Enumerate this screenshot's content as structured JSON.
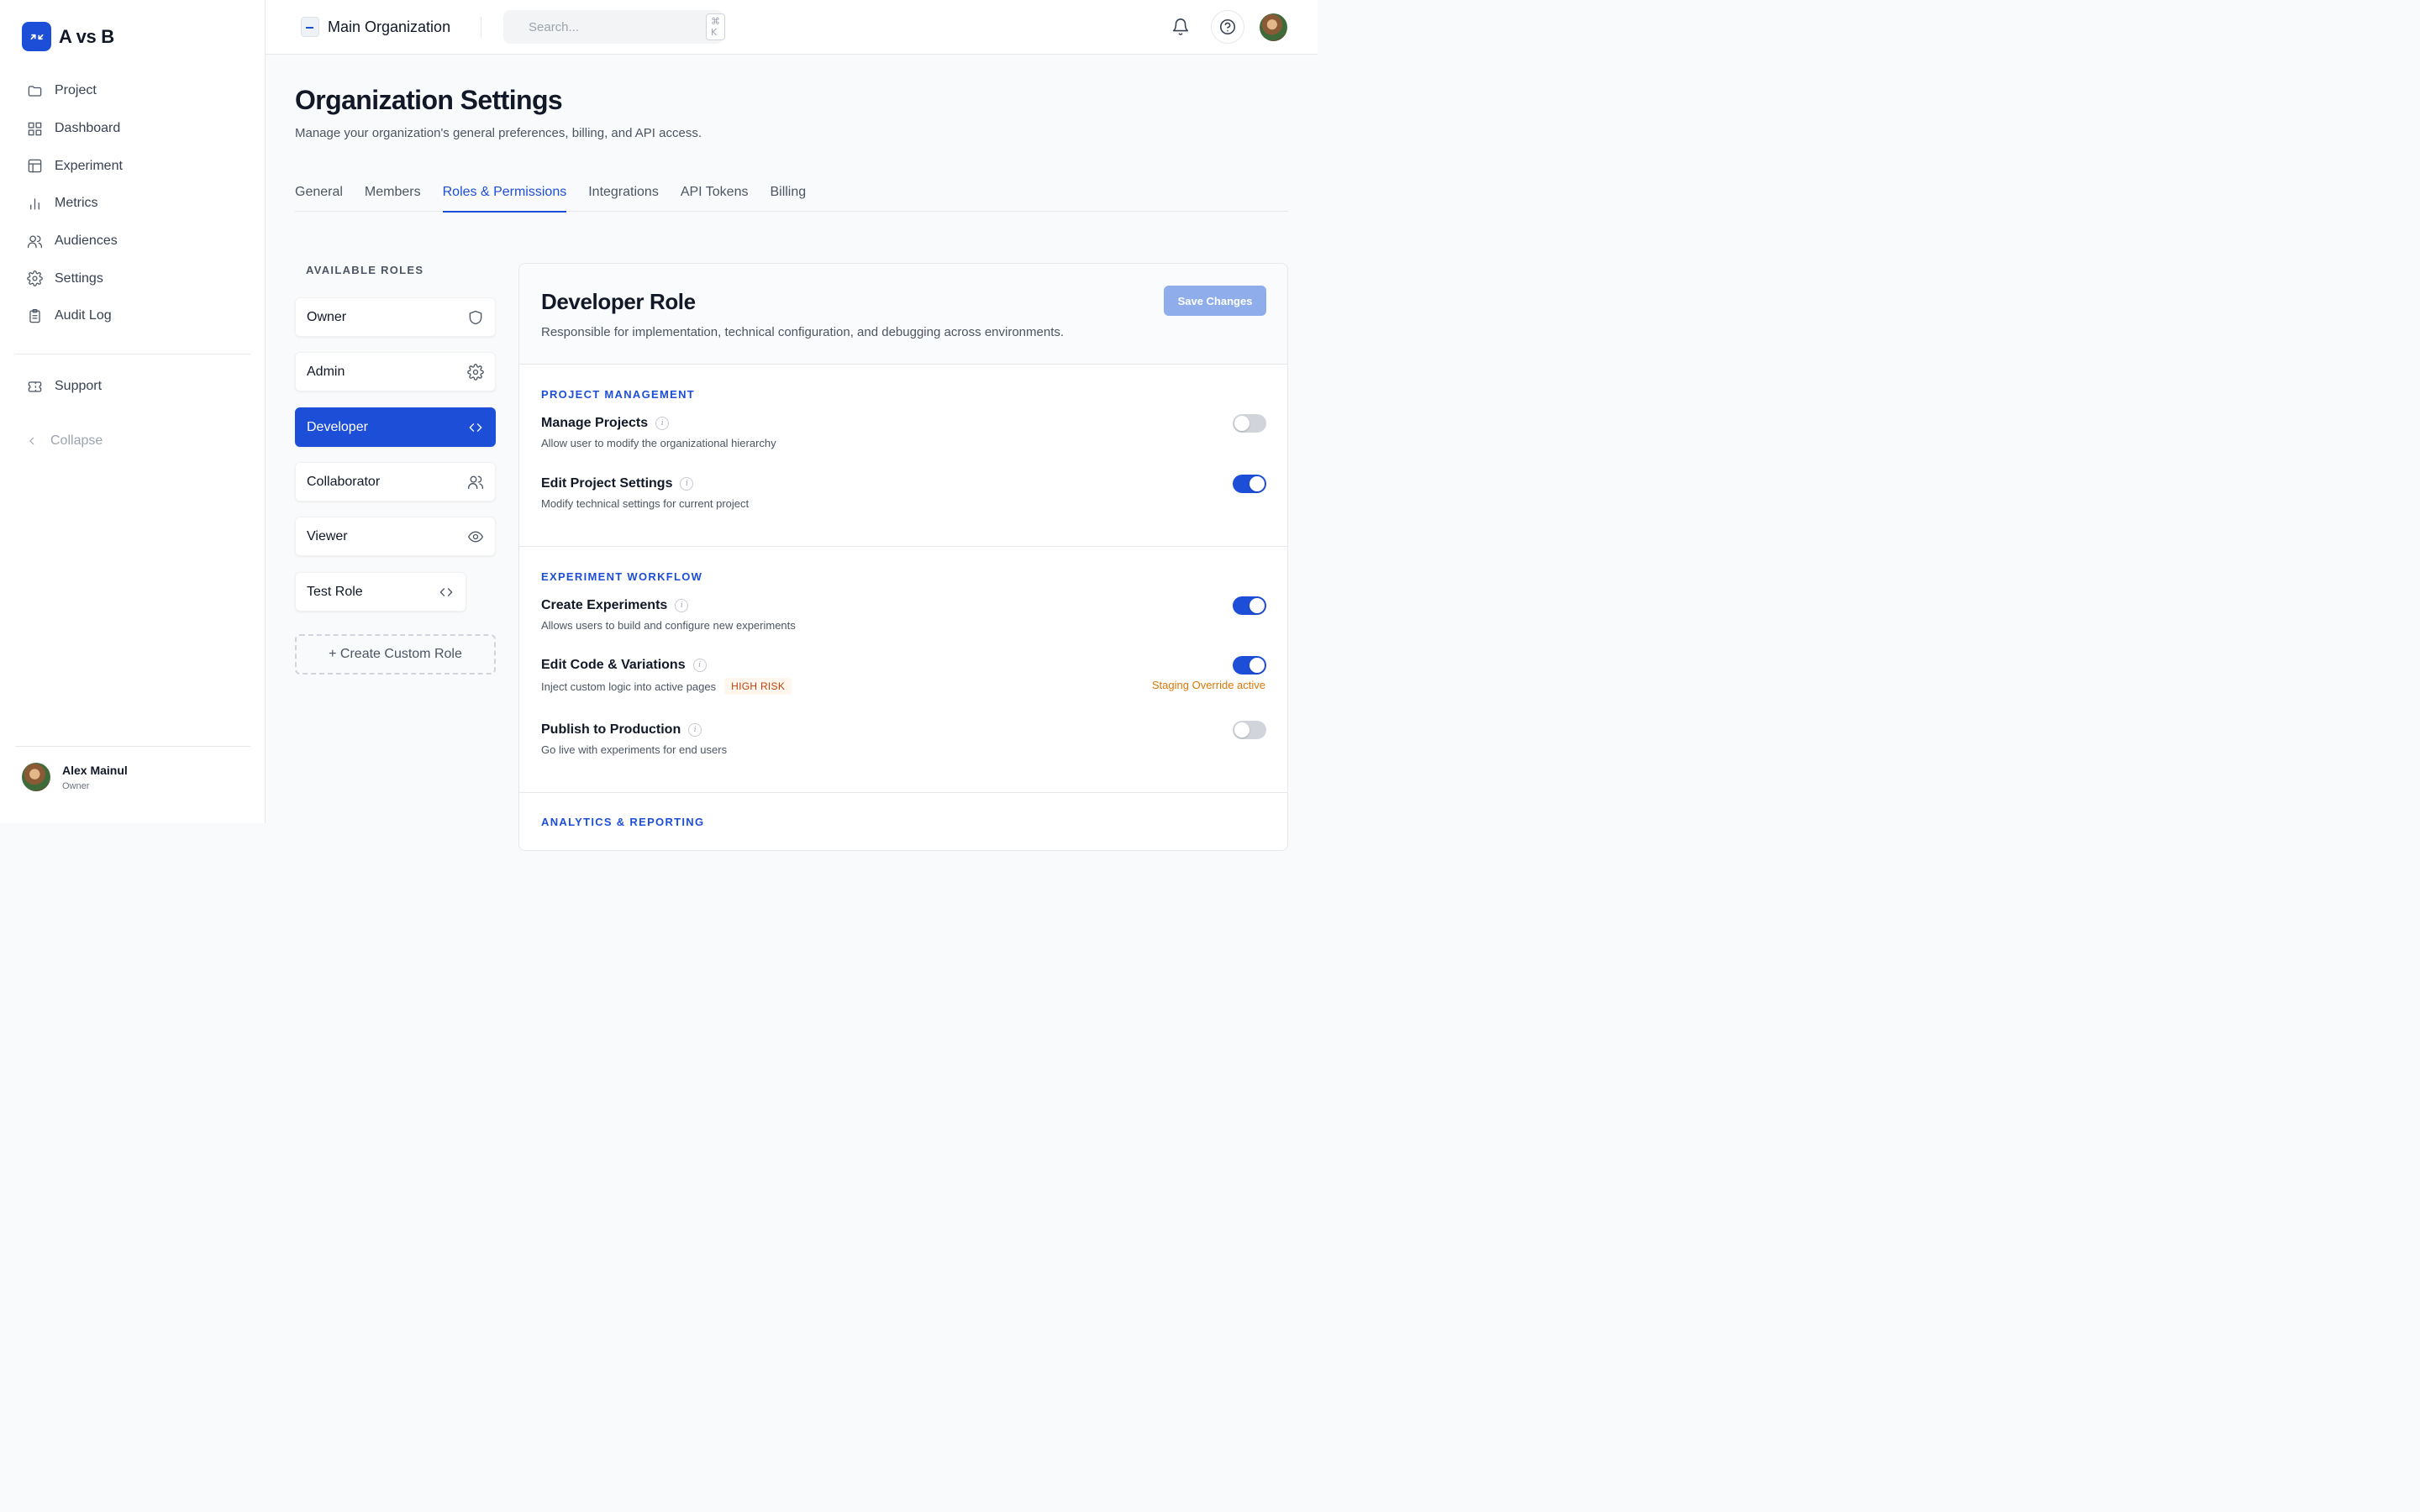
{
  "brand": {
    "name": "A vs B"
  },
  "sidebar": {
    "items": [
      {
        "label": "Project",
        "icon": "folder-icon"
      },
      {
        "label": "Dashboard",
        "icon": "grid-icon"
      },
      {
        "label": "Experiment",
        "icon": "layout-icon"
      },
      {
        "label": "Metrics",
        "icon": "bar-chart-icon"
      },
      {
        "label": "Audiences",
        "icon": "users-icon"
      },
      {
        "label": "Settings",
        "icon": "gear-icon"
      },
      {
        "label": "Audit Log",
        "icon": "clipboard-icon"
      }
    ],
    "support_label": "Support",
    "collapse_label": "Collapse",
    "user": {
      "name": "Alex Mainul",
      "role": "Owner"
    }
  },
  "topbar": {
    "org_name": "Main Organization",
    "search_placeholder": "Search...",
    "search_shortcut": "⌘ K"
  },
  "page": {
    "title": "Organization Settings",
    "subtitle": "Manage your organization's general preferences, billing, and API access.",
    "tabs": [
      {
        "label": "General",
        "active": false
      },
      {
        "label": "Members",
        "active": false
      },
      {
        "label": "Roles & Permissions",
        "active": true
      },
      {
        "label": "Integrations",
        "active": false
      },
      {
        "label": "API Tokens",
        "active": false
      },
      {
        "label": "Billing",
        "active": false
      }
    ]
  },
  "roles": {
    "heading": "AVAILABLE ROLES",
    "items": [
      {
        "label": "Owner",
        "icon": "shield-icon",
        "active": false
      },
      {
        "label": "Admin",
        "icon": "gear-icon",
        "active": false
      },
      {
        "label": "Developer",
        "icon": "code-icon",
        "active": true
      },
      {
        "label": "Collaborator",
        "icon": "users-icon",
        "active": false
      },
      {
        "label": "Viewer",
        "icon": "eye-icon",
        "active": false
      },
      {
        "label": "Test Role",
        "icon": "code-icon",
        "active": false
      }
    ],
    "create_label": "+ Create Custom Role"
  },
  "panel": {
    "title": "Developer Role",
    "description": "Responsible for implementation, technical configuration, and debugging across environments.",
    "save_label": "Save Changes",
    "sections": [
      {
        "title": "PROJECT MANAGEMENT",
        "permissions": [
          {
            "name": "Manage Projects",
            "description": "Allow user to modify the organizational hierarchy",
            "enabled": false
          },
          {
            "name": "Edit Project Settings",
            "description": "Modify technical settings for current project",
            "enabled": true
          }
        ]
      },
      {
        "title": "EXPERIMENT WORKFLOW",
        "permissions": [
          {
            "name": "Create Experiments",
            "description": "Allows users to build and configure new experiments",
            "enabled": true
          },
          {
            "name": "Edit Code & Variations",
            "description": "Inject custom logic into active pages",
            "enabled": true,
            "badge": "HIGH RISK",
            "note": "Staging Override active"
          },
          {
            "name": "Publish to Production",
            "description": "Go live with experiments for end users",
            "enabled": false
          }
        ]
      },
      {
        "title": "ANALYTICS & REPORTING"
      }
    ]
  }
}
